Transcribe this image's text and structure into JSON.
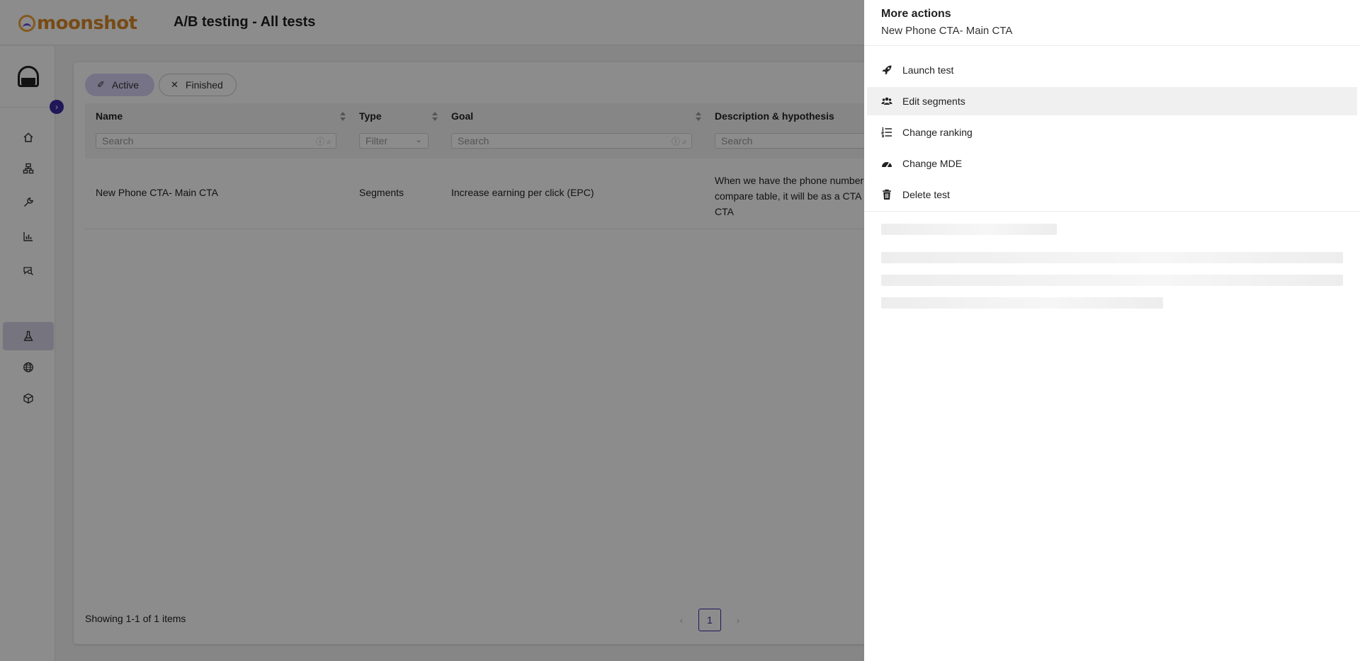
{
  "header": {
    "brand": "moonshot",
    "title": "A/B testing - All tests"
  },
  "sidebar": {
    "collapse_icon": "chevron-right-icon",
    "items": [
      {
        "icon": "home-icon",
        "glyph": "⌂"
      },
      {
        "icon": "sitemap-icon",
        "glyph": "⛁"
      },
      {
        "icon": "wrench-icon",
        "glyph": "✎"
      },
      {
        "icon": "bar-chart-icon",
        "glyph": "▥"
      },
      {
        "icon": "search-chat-icon",
        "glyph": "⌕"
      },
      {
        "icon": "flask-icon",
        "glyph": "⚗",
        "active": true
      },
      {
        "icon": "globe-icon",
        "glyph": "⊕"
      },
      {
        "icon": "cube-icon",
        "glyph": "⬡"
      }
    ]
  },
  "filters": {
    "active_label": "Active",
    "finished_label": "Finished"
  },
  "table": {
    "columns": {
      "name": "Name",
      "type": "Type",
      "goal": "Goal",
      "description": "Description & hypothesis"
    },
    "placeholders": {
      "search": "Search",
      "filter": "Filter"
    },
    "rows": [
      {
        "name": "New Phone CTA- Main CTA",
        "type": "Segments",
        "goal": "Increase earning per click (EPC)",
        "description_lines": [
          "When we have the phone number",
          "compare table, it will be as a CTA",
          "CTA"
        ]
      }
    ]
  },
  "footer": {
    "showing": "Showing 1-1 of 1 items",
    "page": "1"
  },
  "drawer": {
    "title": "More actions",
    "subtitle": "New Phone CTA- Main CTA",
    "actions": [
      {
        "label": "Launch test",
        "icon": "rocket-icon"
      },
      {
        "label": "Edit segments",
        "icon": "users-icon"
      },
      {
        "label": "Change ranking",
        "icon": "list-ordered-icon"
      },
      {
        "label": "Change MDE",
        "icon": "gauge-icon"
      },
      {
        "label": "Delete test",
        "icon": "trash-icon"
      }
    ]
  }
}
